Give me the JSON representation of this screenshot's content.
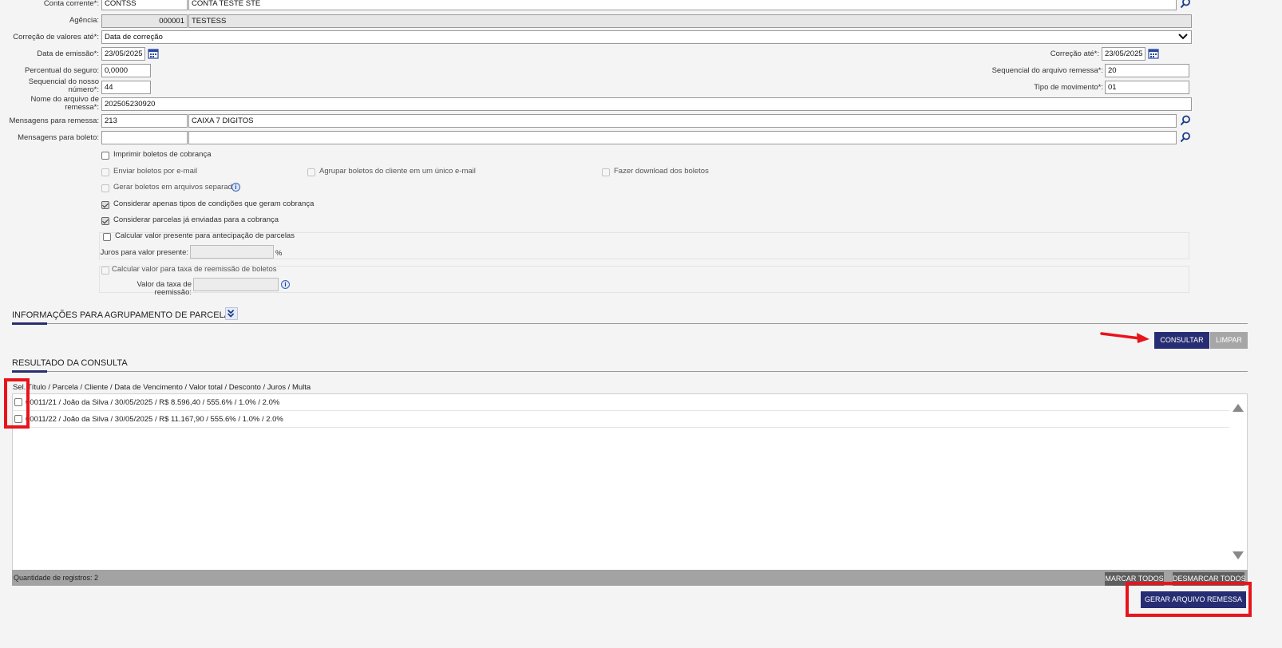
{
  "form": {
    "conta_corrente": {
      "label": "Conta corrente*:",
      "code": "CONTSS",
      "name": "CONTA TESTE STE"
    },
    "agencia": {
      "label": "Agência:",
      "code": "000001",
      "name": "TESTESS"
    },
    "correcao_valores": {
      "label": "Correção de valores até*:",
      "value": "Data de correção"
    },
    "data_emissao": {
      "label": "Data de emissão*:",
      "value": "23/05/2025"
    },
    "correcao_ate": {
      "label": "Correção até*:",
      "value": "23/05/2025"
    },
    "percentual_seguro": {
      "label": "Percentual do seguro:",
      "value": "0,0000"
    },
    "sequencial_arquivo": {
      "label": "Sequencial do arquivo remessa*:",
      "value": "20"
    },
    "sequencial_nosso_numero": {
      "label_line1": "Sequencial do nosso",
      "label_line2": "número*:",
      "value": "44"
    },
    "tipo_movimento": {
      "label": "Tipo de movimento*:",
      "value": "01"
    },
    "nome_arquivo": {
      "label_line1": "Nome do arquivo de",
      "label_line2": "remessa*:",
      "value": "202505230920"
    },
    "mensagens_remessa": {
      "label": "Mensagens para remessa:",
      "code": "213",
      "name": "CAIXA 7 DIGITOS"
    },
    "mensagens_boleto": {
      "label": "Mensagens para boleto:",
      "code": "",
      "name": ""
    }
  },
  "options": {
    "imprimir": {
      "label": "Imprimir boletos de cobrança",
      "checked": false
    },
    "enviar_email": {
      "label": "Enviar boletos por e-mail",
      "checked": false
    },
    "agrupar": {
      "label": "Agrupar boletos do cliente em um único e-mail",
      "checked": false
    },
    "download": {
      "label": "Fazer download dos boletos",
      "checked": false
    },
    "gerar_separados": {
      "label": "Gerar boletos em arquivos separados",
      "checked": false
    },
    "considerar_tipos": {
      "label": "Considerar apenas tipos de condições que geram cobrança",
      "checked": true
    },
    "considerar_parcelas": {
      "label": "Considerar parcelas já enviadas para a cobrança",
      "checked": true
    },
    "calc_valor_presente": {
      "label": "Calcular valor presente para antecipação de parcelas",
      "checked": false
    },
    "juros_valor_presente": {
      "label": "Juros para valor presente:",
      "value": "",
      "unit": "%"
    },
    "calc_taxa_reemissao": {
      "label": "Calcular valor para taxa de reemissão de boletos",
      "checked": false
    },
    "valor_taxa_reemissao": {
      "label": "Valor da taxa de reemissão:",
      "value": ""
    }
  },
  "sections": {
    "agrupamento": "INFORMAÇÕES PARA AGRUPAMENTO DE PARCELAS",
    "resultado": "RESULTADO DA CONSULTA"
  },
  "buttons": {
    "consultar": "CONSULTAR",
    "limpar": "LIMPAR",
    "marcar_todos": "MARCAR TODOS",
    "desmarcar_todos": "DESMARCAR TODOS",
    "gerar_arquivo": "GERAR ARQUIVO REMESSA"
  },
  "table": {
    "header_sel": "Sel.",
    "header_cols": "Título / Parcela / Cliente / Data de Vencimento / Valor total / Desconto / Juros / Multa",
    "rows": [
      "00011/21 / João da Silva / 30/05/2025 / R$ 8.596,40 / 555.6% / 1.0% / 2.0%",
      "00011/22 / João da Silva / 30/05/2025 / R$ 11.167,90 / 555.6% / 1.0% / 2.0%"
    ],
    "count_label": "Quantidade de registros: 2"
  },
  "colors": {
    "primary_button": "#272d73",
    "disabled_button": "#a6a6a6",
    "annotation_red": "#e8141b"
  }
}
